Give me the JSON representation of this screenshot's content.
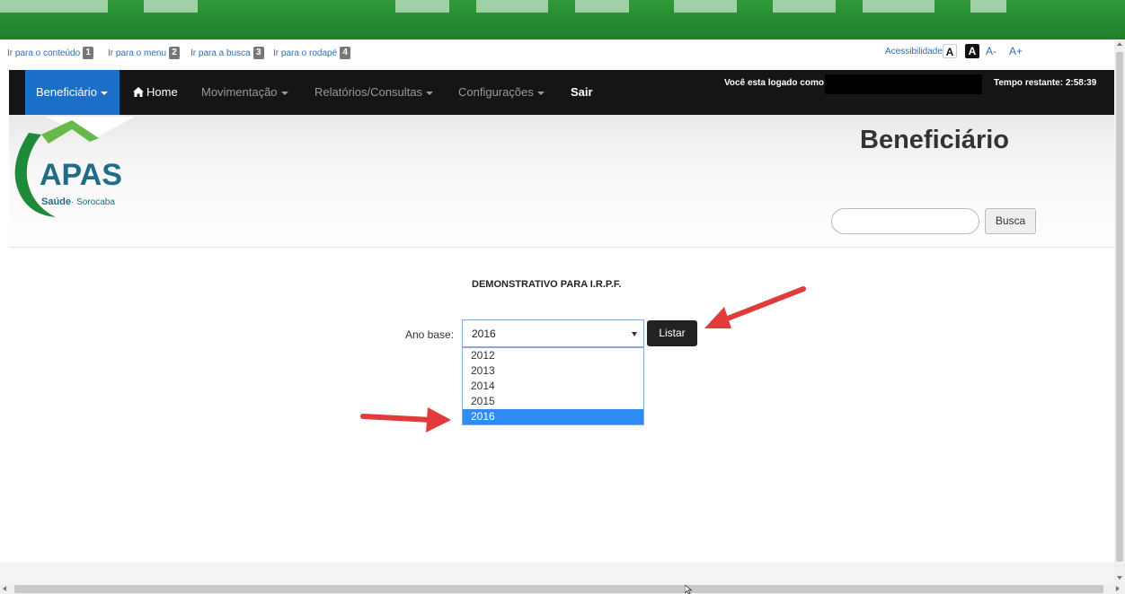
{
  "skip_links": [
    {
      "label": "Ir para o conteúdo",
      "num": "1"
    },
    {
      "label": "Ir para o menu",
      "num": "2"
    },
    {
      "label": "Ir para a busca",
      "num": "3"
    },
    {
      "label": "Ir para o rodapé",
      "num": "4"
    }
  ],
  "accessibility": {
    "label": "Acessibilidade",
    "font_normal": "A",
    "font_contrast": "A",
    "font_decrease": "A-",
    "font_increase": "A+"
  },
  "navbar": {
    "beneficiario": "Beneficiário",
    "home": "Home",
    "movimentacao": "Movimentação",
    "relatorios": "Relatórios/Consultas",
    "configuracoes": "Configurações",
    "sair": "Sair",
    "logged_text": "Você esta logado como",
    "tempo_restante": "Tempo restante: 2:58:39"
  },
  "header": {
    "logo_text": "APAS",
    "logo_sub_bold": "Saúde",
    "logo_sub": "· Sorocaba",
    "page_title": "Beneficiário",
    "search_placeholder": "",
    "search_button": "Busca"
  },
  "main": {
    "section_title": "DEMONSTRATIVO PARA I.R.P.F.",
    "ano_base_label": "Ano base:",
    "selected_year": "2016",
    "listar_button": "Listar",
    "options": [
      "2012",
      "2013",
      "2014",
      "2015",
      "2016"
    ]
  },
  "colors": {
    "banner_green": "#1f7f2a",
    "navbar_bg": "#151515",
    "nav_active": "#1a6fc8",
    "selected_option": "#2f8cf2",
    "arrow_red": "#e23b3b"
  }
}
